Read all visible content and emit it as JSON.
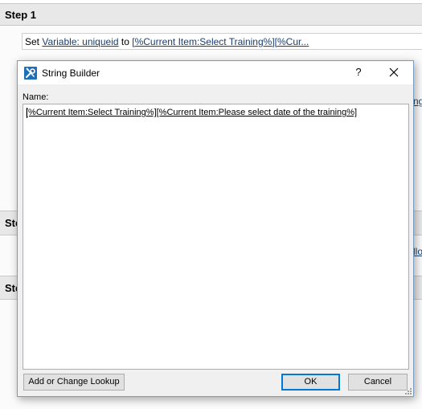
{
  "background": {
    "step1": {
      "title": "Step 1",
      "action": {
        "set_word": "Set",
        "variable_link": "Variable: uniqueid",
        "to_word": "to",
        "value_link": "[%Current Item:Select Training%][%Cur..."
      },
      "cut_text_right_1": "ng",
      "cut_text_right_2": "llo"
    },
    "step2": {
      "title": "Ste"
    },
    "step3": {
      "title": "Ste"
    }
  },
  "dialog": {
    "title": "String Builder",
    "help_label": "?",
    "name_label": "Name:",
    "text_value": "[%Current Item:Select Training%][%Current Item:Please select date of the training%]",
    "buttons": {
      "lookup": "Add or Change Lookup",
      "ok": "OK",
      "cancel": "Cancel"
    }
  },
  "colors": {
    "step_header_bg": "#e8e8e8",
    "link": "#1a3e6e",
    "dialog_border": "#7a9bbd",
    "dialog_icon_bg": "#1f6fb8",
    "ok_focus_border": "#0078d7"
  },
  "icons": {
    "title_icon": "tools-icon",
    "close_icon": "close-icon",
    "resize_grip": "resize-grip-icon"
  }
}
